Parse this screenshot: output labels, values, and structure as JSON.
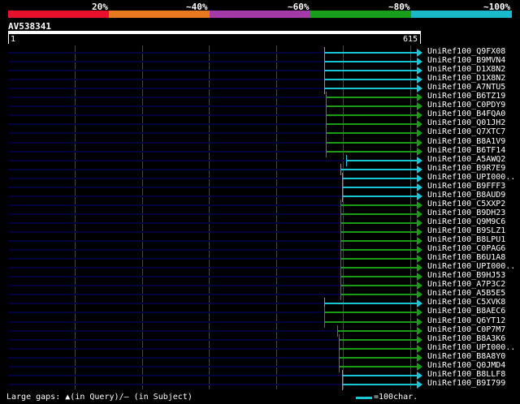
{
  "scale": {
    "labels": [
      "20%",
      "~40%",
      "~60%",
      "~80%",
      "~100%"
    ],
    "colors": [
      "#e8102a",
      "#e8791e",
      "#a23aa8",
      "#189e1b",
      "#1ab9c8"
    ]
  },
  "query": {
    "id": "AV538341",
    "start": "1",
    "end": "615"
  },
  "colors": {
    "blue_hit": "#18c6d6",
    "green_hit": "#1a9c16",
    "background_line": "#00003c"
  },
  "hits": [
    {
      "label": "UniRef100_Q9FX08",
      "color": "blue",
      "start": 399
    },
    {
      "label": "UniRef100_B9MVN4",
      "color": "blue",
      "start": 399
    },
    {
      "label": "UniRef100_D1X8N2",
      "color": "blue",
      "start": 399
    },
    {
      "label": "UniRef100_D1X8N2",
      "color": "blue",
      "start": 399
    },
    {
      "label": "UniRef100_A7NTU5",
      "color": "blue",
      "start": 399
    },
    {
      "label": "UniRef100_B6TZ19",
      "color": "green",
      "start": 401
    },
    {
      "label": "UniRef100_C0PDY9",
      "color": "green",
      "start": 401
    },
    {
      "label": "UniRef100_B4FQA0",
      "color": "green",
      "start": 401
    },
    {
      "label": "UniRef100_Q01JH2",
      "color": "green",
      "start": 401
    },
    {
      "label": "UniRef100_Q7XTC7",
      "color": "green",
      "start": 401
    },
    {
      "label": "UniRef100_B8A1V9",
      "color": "green",
      "start": 401
    },
    {
      "label": "UniRef100_B6TF14",
      "color": "green",
      "start": 401
    },
    {
      "label": "UniRef100_A5AWQ2",
      "color": "blue",
      "start": 426
    },
    {
      "label": "UniRef100_B9R7E9",
      "color": "blue",
      "start": 419
    },
    {
      "label": "UniRef100_UPI000..",
      "color": "blue",
      "start": 421
    },
    {
      "label": "UniRef100_B9FFF3",
      "color": "blue",
      "start": 421
    },
    {
      "label": "UniRef100_B8AUD9",
      "color": "blue",
      "start": 421
    },
    {
      "label": "UniRef100_C5XXP2",
      "color": "green",
      "start": 419
    },
    {
      "label": "UniRef100_B9DH23",
      "color": "green",
      "start": 419
    },
    {
      "label": "UniRef100_Q9M9C6",
      "color": "green",
      "start": 419
    },
    {
      "label": "UniRef100_B9SLZ1",
      "color": "green",
      "start": 419
    },
    {
      "label": "UniRef100_B8LPU1",
      "color": "green",
      "start": 419
    },
    {
      "label": "UniRef100_C0PAG6",
      "color": "green",
      "start": 419
    },
    {
      "label": "UniRef100_B6U1A8",
      "color": "green",
      "start": 419
    },
    {
      "label": "UniRef100_UPI000..",
      "color": "green",
      "start": 419
    },
    {
      "label": "UniRef100_B9HJ53",
      "color": "green",
      "start": 419
    },
    {
      "label": "UniRef100_A7P3C2",
      "color": "green",
      "start": 419
    },
    {
      "label": "UniRef100_A5B5E5",
      "color": "green",
      "start": 419
    },
    {
      "label": "UniRef100_C5XVK8",
      "color": "blue",
      "start": 399
    },
    {
      "label": "UniRef100_B8AEC6",
      "color": "green",
      "start": 399
    },
    {
      "label": "UniRef100_Q6YT12",
      "color": "green",
      "start": 399
    },
    {
      "label": "UniRef100_C0P7M7",
      "color": "green",
      "start": 415
    },
    {
      "label": "UniRef100_B8A3K6",
      "color": "green",
      "start": 417
    },
    {
      "label": "UniRef100_UPI000..",
      "color": "green",
      "start": 417
    },
    {
      "label": "UniRef100_B8A8Y0",
      "color": "green",
      "start": 417
    },
    {
      "label": "UniRef100_Q0JMD4",
      "color": "green",
      "start": 417
    },
    {
      "label": "UniRef100_B8LLF8",
      "color": "blue",
      "start": 421
    },
    {
      "label": "UniRef100_B9I799",
      "color": "blue",
      "start": 421
    }
  ],
  "footer": {
    "large_gaps_label": "Large gaps:",
    "in_query_label": "(in Query)/",
    "dash_glyph": "—",
    "in_subject_label": "(in Subject)",
    "scale_note": "=100char."
  }
}
